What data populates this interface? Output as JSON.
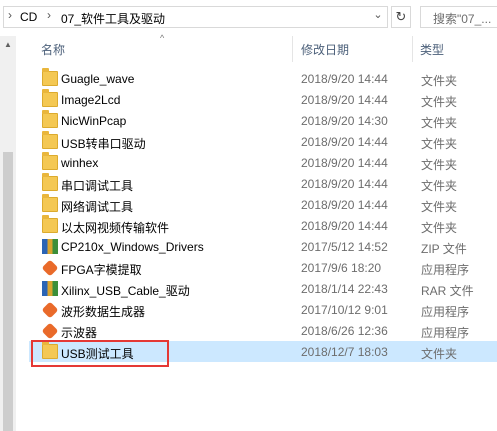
{
  "address": {
    "crumbs": [
      "CD",
      "07_软件工具及驱动"
    ],
    "search_placeholder": "搜索\"07_..."
  },
  "columns": {
    "name": "名称",
    "date": "修改日期",
    "type": "类型"
  },
  "files": [
    {
      "name": "Guagle_wave",
      "date": "2018/9/20 14:44",
      "type": "文件夹",
      "icon": "folder-icon"
    },
    {
      "name": "Image2Lcd",
      "date": "2018/9/20 14:44",
      "type": "文件夹",
      "icon": "folder-icon"
    },
    {
      "name": "NicWinPcap",
      "date": "2018/9/20 14:30",
      "type": "文件夹",
      "icon": "folder-icon"
    },
    {
      "name": "USB转串口驱动",
      "date": "2018/9/20 14:44",
      "type": "文件夹",
      "icon": "folder-icon"
    },
    {
      "name": "winhex",
      "date": "2018/9/20 14:44",
      "type": "文件夹",
      "icon": "folder-icon"
    },
    {
      "name": "串口调试工具",
      "date": "2018/9/20 14:44",
      "type": "文件夹",
      "icon": "folder-icon"
    },
    {
      "name": "网络调试工具",
      "date": "2018/9/20 14:44",
      "type": "文件夹",
      "icon": "folder-icon"
    },
    {
      "name": "以太网视频传输软件",
      "date": "2018/9/20 14:44",
      "type": "文件夹",
      "icon": "folder-icon"
    },
    {
      "name": "CP210x_Windows_Drivers",
      "date": "2017/5/12 14:52",
      "type": "ZIP 文件",
      "icon": "zip-icon"
    },
    {
      "name": "FPGA字模提取",
      "date": "2017/9/6 18:20",
      "type": "应用程序",
      "icon": "app-icon"
    },
    {
      "name": "Xilinx_USB_Cable_驱动",
      "date": "2018/1/14 22:43",
      "type": "RAR 文件",
      "icon": "rar-icon"
    },
    {
      "name": "波形数据生成器",
      "date": "2017/10/12 9:01",
      "type": "应用程序",
      "icon": "app-icon"
    },
    {
      "name": "示波器",
      "date": "2018/6/26 12:36",
      "type": "应用程序",
      "icon": "app-icon"
    },
    {
      "name": "USB测试工具",
      "date": "2018/12/7 18:03",
      "type": "文件夹",
      "icon": "folder-icon",
      "selected": true
    }
  ],
  "colors": {
    "selection": "#cce8ff",
    "highlight_border": "#e53935",
    "folder": "#f4c853"
  }
}
